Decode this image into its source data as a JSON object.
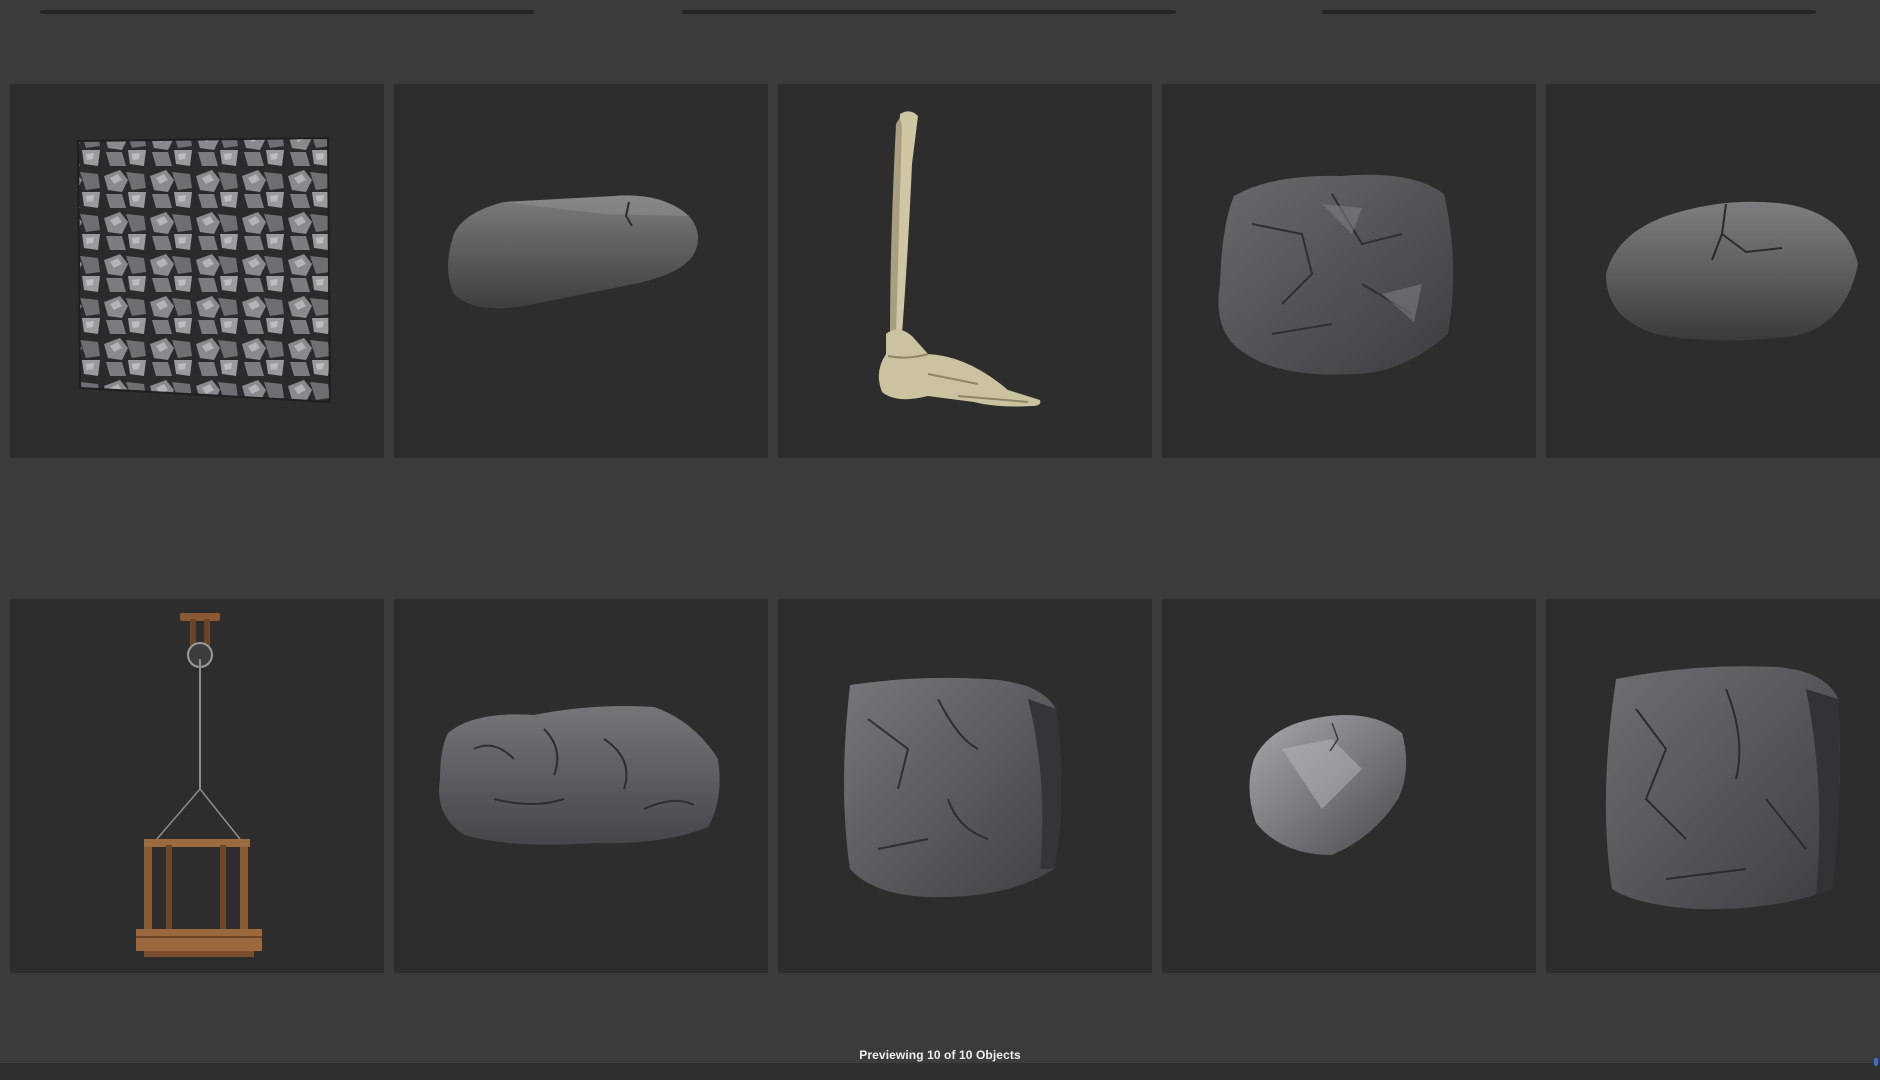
{
  "status": {
    "preview_text": "Previewing 10 of 10 Objects"
  },
  "colors": {
    "background": "#3b3b3b",
    "tile_background": "#2d2d2d",
    "status_bar": "#2f2f2f",
    "accent": "#3b6fd6"
  },
  "grid": {
    "columns": 5,
    "rows": 2,
    "items": [
      {
        "icon": "rock-surface-tile-preview"
      },
      {
        "icon": "flat-cracked-boulder-preview"
      },
      {
        "icon": "leg-bone-skeleton-preview"
      },
      {
        "icon": "rough-rock-block-preview"
      },
      {
        "icon": "cracked-pebble-preview"
      },
      {
        "icon": "pulley-crane-cage-preview"
      },
      {
        "icon": "lumpy-rock-slab-preview"
      },
      {
        "icon": "square-rock-block-preview"
      },
      {
        "icon": "small-faceted-stone-preview"
      },
      {
        "icon": "tall-rock-block-preview"
      }
    ]
  }
}
